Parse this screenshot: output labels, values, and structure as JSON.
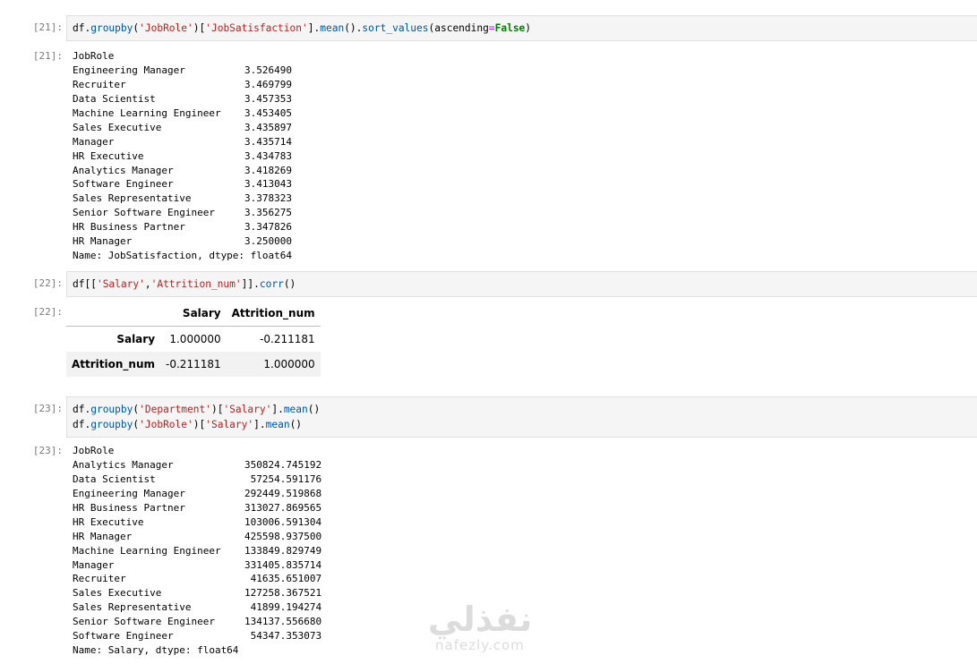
{
  "cells": [
    {
      "in_prompt": "[21]:",
      "code_lines": [
        [
          {
            "t": "df.",
            "k": "n"
          },
          {
            "t": "groupby",
            "k": "fn"
          },
          {
            "t": "(",
            "k": "n"
          },
          {
            "t": "'JobRole'",
            "k": "str"
          },
          {
            "t": ")[",
            "k": "n"
          },
          {
            "t": "'JobSatisfaction'",
            "k": "str"
          },
          {
            "t": "].",
            "k": "n"
          },
          {
            "t": "mean",
            "k": "fn"
          },
          {
            "t": "().",
            "k": "n"
          },
          {
            "t": "sort_values",
            "k": "fn"
          },
          {
            "t": "(ascending",
            "k": "n"
          },
          {
            "t": "=",
            "k": "op"
          },
          {
            "t": "False",
            "k": "kw"
          },
          {
            "t": ")",
            "k": "n"
          }
        ]
      ],
      "out_prompt": "[21]:",
      "output_lines": [
        "JobRole",
        "Engineering Manager          3.526490",
        "Recruiter                    3.469799",
        "Data Scientist               3.457353",
        "Machine Learning Engineer    3.453405",
        "Sales Executive              3.435897",
        "Manager                      3.435714",
        "HR Executive                 3.434783",
        "Analytics Manager            3.418269",
        "Software Engineer            3.413043",
        "Sales Representative         3.378323",
        "Senior Software Engineer     3.356275",
        "HR Business Partner          3.347826",
        "HR Manager                   3.250000",
        "Name: JobSatisfaction, dtype: float64"
      ]
    },
    {
      "in_prompt": "[22]:",
      "code_lines": [
        [
          {
            "t": "df[[",
            "k": "n"
          },
          {
            "t": "'Salary'",
            "k": "str"
          },
          {
            "t": ",",
            "k": "n"
          },
          {
            "t": "'Attrition_num'",
            "k": "str"
          },
          {
            "t": "]].",
            "k": "n"
          },
          {
            "t": "corr",
            "k": "fn"
          },
          {
            "t": "()",
            "k": "n"
          }
        ]
      ],
      "out_prompt": "[22]:",
      "table": {
        "columns": [
          "",
          "Salary",
          "Attrition_num"
        ],
        "rows": [
          {
            "index": "Salary",
            "values": [
              "1.000000",
              "-0.211181"
            ]
          },
          {
            "index": "Attrition_num",
            "values": [
              "-0.211181",
              "1.000000"
            ]
          }
        ]
      }
    },
    {
      "in_prompt": "[23]:",
      "code_lines": [
        [
          {
            "t": "df.",
            "k": "n"
          },
          {
            "t": "groupby",
            "k": "fn"
          },
          {
            "t": "(",
            "k": "n"
          },
          {
            "t": "'Department'",
            "k": "str"
          },
          {
            "t": ")[",
            "k": "n"
          },
          {
            "t": "'Salary'",
            "k": "str"
          },
          {
            "t": "].",
            "k": "n"
          },
          {
            "t": "mean",
            "k": "fn"
          },
          {
            "t": "()",
            "k": "n"
          }
        ],
        [
          {
            "t": "df.",
            "k": "n"
          },
          {
            "t": "groupby",
            "k": "fn"
          },
          {
            "t": "(",
            "k": "n"
          },
          {
            "t": "'JobRole'",
            "k": "str"
          },
          {
            "t": ")[",
            "k": "n"
          },
          {
            "t": "'Salary'",
            "k": "str"
          },
          {
            "t": "].",
            "k": "n"
          },
          {
            "t": "mean",
            "k": "fn"
          },
          {
            "t": "()",
            "k": "n"
          }
        ]
      ],
      "out_prompt": "[23]:",
      "output_lines": [
        "JobRole",
        "Analytics Manager            350824.745192",
        "Data Scientist                57254.591176",
        "Engineering Manager          292449.519868",
        "HR Business Partner          313027.869565",
        "HR Executive                 103006.591304",
        "HR Manager                   425598.937500",
        "Machine Learning Engineer    133849.829749",
        "Manager                      331405.835714",
        "Recruiter                     41635.651007",
        "Sales Executive              127258.367521",
        "Sales Representative          41899.194274",
        "Senior Software Engineer     134137.556680",
        "Software Engineer             54347.353073",
        "Name: Salary, dtype: float64"
      ]
    }
  ],
  "watermark": {
    "arabic": "نفذلي",
    "latin": "nafezly.com"
  },
  "colors": {
    "string": "#ba2121",
    "keyword": "#008000",
    "function": "#0055aa",
    "operator": "#aa22ff",
    "prompt": "#7a7a7a",
    "cell_bg": "#f5f5f5"
  }
}
